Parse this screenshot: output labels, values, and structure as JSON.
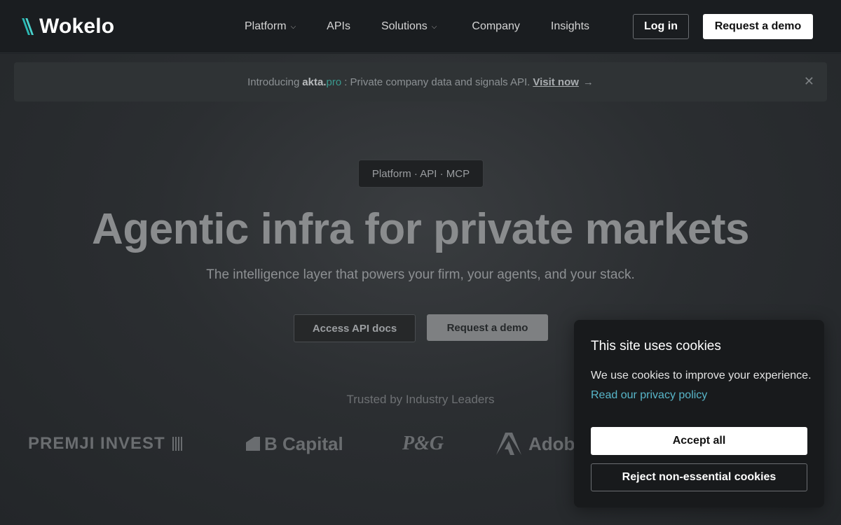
{
  "header": {
    "logo_text": "Wokelo",
    "nav": [
      {
        "label": "Platform",
        "has_dropdown": true
      },
      {
        "label": "APIs",
        "has_dropdown": false
      },
      {
        "label": "Solutions",
        "has_dropdown": true
      },
      {
        "label": "Company",
        "has_dropdown": false
      },
      {
        "label": "Insights",
        "has_dropdown": false
      }
    ],
    "login_label": "Log in",
    "demo_label": "Request a demo"
  },
  "announcement": {
    "prefix": "Introducing",
    "brand_main": "akta.",
    "brand_suffix": "pro",
    "text": ": Private company data and signals API.",
    "link": "Visit now",
    "arrow": "→",
    "close": "✕"
  },
  "hero": {
    "pill": "Platform · API · MCP",
    "headline": "Agentic infra for private markets",
    "subhead": "The intelligence layer that powers your firm, your agents, and your stack.",
    "api_button": "Access API docs",
    "demo_button": "Request a demo",
    "trusted": "Trusted by Industry Leaders",
    "logos": [
      "PREMJI INVEST",
      "B Capital",
      "P&G",
      "Adobe"
    ]
  },
  "cookie": {
    "title": "This site uses cookies",
    "text": "We use cookies to improve your experience.",
    "link": "Read our privacy policy",
    "accept": "Accept all",
    "reject": "Reject non-essential cookies"
  },
  "colors": {
    "accent_teal": "#2bb9b4",
    "link_blue": "#58b6c9",
    "background": "#1e2124"
  }
}
